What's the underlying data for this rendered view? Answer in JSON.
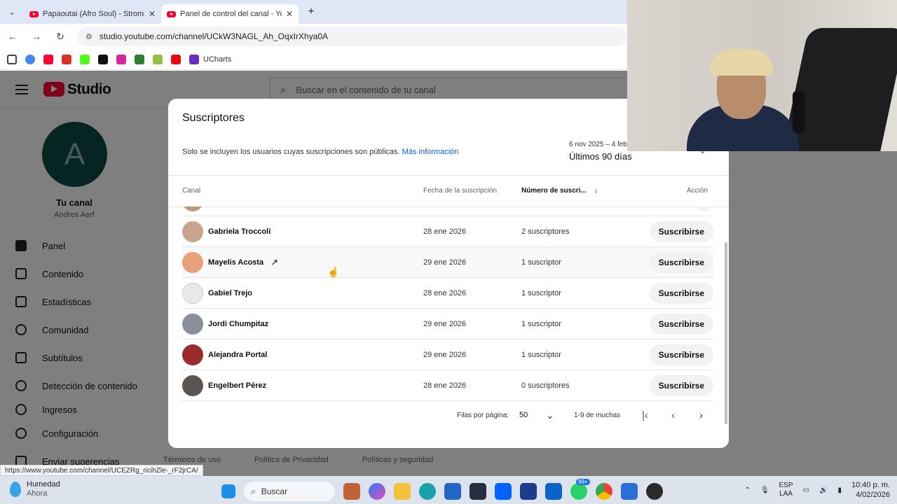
{
  "browser": {
    "tabs": [
      {
        "title": "Papaoutai (Afro Soul) - Stromae"
      },
      {
        "title": "Panel de control del canal - YouTube"
      }
    ],
    "url": "studio.youtube.com/channel/UCkW3NAGL_Ah_OqxIrXhya0A",
    "bookmarks_label": "UCharts",
    "status_url": "https://www.youtube.com/channel/UCEZRg_ricihZle-_rF2jrCA/"
  },
  "studio": {
    "logo": "Studio",
    "search_placeholder": "Buscar en el contenido de tu canal",
    "avatar_letter": "A",
    "channel_title": "Tu canal",
    "channel_owner": "Andres Aerf",
    "nav": [
      {
        "label": "Panel",
        "icon": "dashboard-icon"
      },
      {
        "label": "Contenido",
        "icon": "content-icon"
      },
      {
        "label": "Estadísticas",
        "icon": "analytics-icon"
      },
      {
        "label": "Comunidad",
        "icon": "community-icon"
      },
      {
        "label": "Subtítulos",
        "icon": "subtitles-icon"
      },
      {
        "label": "Detección de contenido",
        "icon": "copyright-icon"
      },
      {
        "label": "Ingresos",
        "icon": "earn-icon"
      }
    ],
    "settings_label": "Configuración",
    "feedback_label": "Enviar sugerencias",
    "footer": [
      "Términos de uso",
      "Política de Privacidad",
      "Políticas y seguridad"
    ]
  },
  "modal": {
    "title": "Suscriptores",
    "note": "Solo se incluyen los usuarios cuyas suscripciones son públicas.",
    "note_link": "Más información",
    "date_range": "6 nov 2025 – 4 feb",
    "date_label": "Últimos 90 días",
    "columns": {
      "channel": "Canal",
      "date": "Fecha de la suscripción",
      "subs": "Número de suscri...",
      "action": "Acción"
    },
    "rows": [
      {
        "name": "Gabriela Troccoli",
        "date": "28 ene 2026",
        "subs": "2 suscriptores",
        "button": "Suscribirse",
        "color": "#c9a48c"
      },
      {
        "name": "Mayelis Acosta",
        "date": "29 ene 2026",
        "subs": "1 suscriptor",
        "button": "Suscribirse",
        "color": "#e8a07a",
        "hover": true
      },
      {
        "name": "Gabiel Trejo",
        "date": "28 ene 2026",
        "subs": "1 suscriptor",
        "button": "Suscribirse",
        "color": "#e8e8e8"
      },
      {
        "name": "Jordi Chumpitaz",
        "date": "29 ene 2026",
        "subs": "1 suscriptor",
        "button": "Suscribirse",
        "color": "#8a8f99"
      },
      {
        "name": "Alejandra Portal",
        "date": "29 ene 2026",
        "subs": "1 suscriptor",
        "button": "Suscribirse",
        "color": "#9b2a2a"
      },
      {
        "name": "Engelbert Pérez",
        "date": "28 ene 2026",
        "subs": "0 suscriptores",
        "button": "Suscribirse",
        "color": "#5a5550"
      }
    ],
    "pager": {
      "rows_label": "Filas por página:",
      "rows_value": "50",
      "range": "1-9 de muchas"
    }
  },
  "taskbar": {
    "weather_title": "Humedad",
    "weather_sub": "Ahora",
    "search": "Buscar",
    "badge": "99+",
    "lang_1": "ESP",
    "lang_2": "LAA",
    "time": "10:40 p. m.",
    "date": "4/02/2026"
  },
  "colors": {
    "accent": "#065fd4",
    "brand_red": "#ff0033",
    "avatar_bg": "#0d4a45"
  }
}
